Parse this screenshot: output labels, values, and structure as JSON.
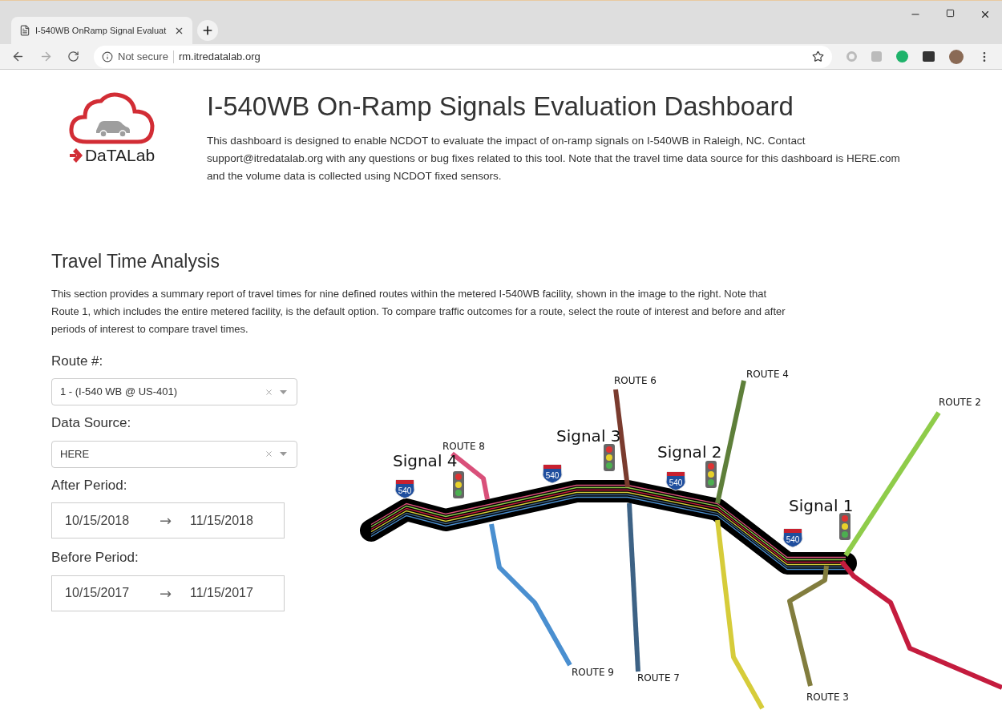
{
  "browser": {
    "tab": {
      "title": "I-540WB OnRamp Signal Evaluat",
      "selected": true
    },
    "security": "Not secure",
    "url": "rm.itredatalab.org"
  },
  "header": {
    "logo_text": "DaTALab",
    "title": "I-540WB On-Ramp Signals Evaluation Dashboard",
    "description": "This dashboard is designed to enable NCDOT to evaluate the impact of on-ramp signals on I-540WB in Raleigh, NC. Contact support@itredatalab.org with any questions or bug fixes related to this tool. Note that the travel time data source for this dashboard is HERE.com and the volume data is collected using NCDOT fixed sensors."
  },
  "section": {
    "title": "Travel Time Analysis",
    "description": "This section provides a summary report of travel times for nine defined routes within the metered I-540WB facility, shown in the image to the right. Note that Route 1, which includes the entire metered facility, is the default option. To compare traffic outcomes for a route, select the route of interest and before and after periods of interest to compare travel times."
  },
  "controls": [
    {
      "kind": "select",
      "label": "Route #:",
      "value": "1 - (I-540 WB @ US-401)"
    },
    {
      "kind": "select",
      "label": "Data Source:",
      "value": "HERE"
    },
    {
      "kind": "range",
      "label": "After Period:",
      "start": "10/15/2018",
      "arrow": "→",
      "end": "11/15/2018"
    },
    {
      "kind": "range",
      "label": "Before Period:",
      "start": "10/15/2017",
      "arrow": "→",
      "end": "11/15/2017"
    }
  ],
  "map": {
    "signals": [
      "Signal 4",
      "Signal 3",
      "Signal 2",
      "Signal 1"
    ],
    "shields": [
      "540",
      "540",
      "540",
      "540"
    ],
    "routes": [
      {
        "label": "ROUTE 8",
        "color": "#d9507a"
      },
      {
        "label": "ROUTE 9",
        "color": "#4a8fd0"
      },
      {
        "label": "ROUTE 6",
        "color": "#7a3b2e"
      },
      {
        "label": "ROUTE 7",
        "color": "#3d6285"
      },
      {
        "label": "ROUTE 4",
        "color": "#5e7f3a"
      },
      {
        "color": "#d6cc3a"
      },
      {
        "label": "ROUTE 2",
        "color": "#8fcc4a"
      },
      {
        "label": "ROUTE 3",
        "color": "#827d3e"
      },
      {
        "color": "#c41c3e"
      }
    ]
  }
}
